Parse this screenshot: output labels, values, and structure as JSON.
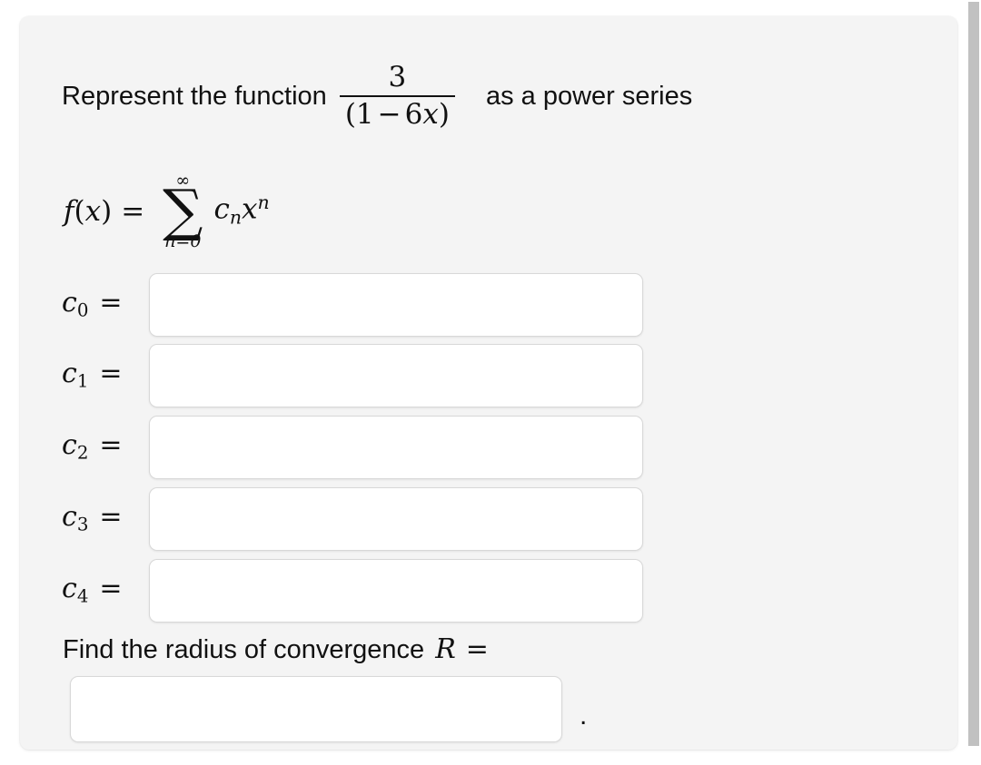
{
  "problem": {
    "statement_prefix": "Represent the function",
    "statement_suffix": "as a power series",
    "function": {
      "numerator": "3",
      "denominator_open": "(1",
      "denominator_minus": "−",
      "denominator_coefficient": "6",
      "denominator_variable": "x",
      "denominator_close": ")"
    },
    "series_definition": {
      "lhs_f": "f",
      "lhs_open": "(",
      "lhs_var": "x",
      "lhs_close": ")",
      "equals": "=",
      "sum_symbol": "∑",
      "sum_upper_limit": "∞",
      "sum_lower_limit": "n=0",
      "term_coefficient": "c",
      "term_coefficient_sub": "n",
      "term_variable": "x",
      "term_exponent": "n"
    },
    "coefficients": [
      {
        "label": "c",
        "subscript": "0",
        "equals": "=",
        "value": "",
        "placeholder": ""
      },
      {
        "label": "c",
        "subscript": "1",
        "equals": "=",
        "value": "",
        "placeholder": ""
      },
      {
        "label": "c",
        "subscript": "2",
        "equals": "=",
        "value": "",
        "placeholder": ""
      },
      {
        "label": "c",
        "subscript": "3",
        "equals": "=",
        "value": "",
        "placeholder": ""
      },
      {
        "label": "c",
        "subscript": "4",
        "equals": "=",
        "value": "",
        "placeholder": ""
      }
    ],
    "radius": {
      "prompt": "Find the radius of convergence",
      "symbol": "R",
      "equals": "=",
      "value": "",
      "placeholder": "",
      "trailing_punctuation": "."
    }
  },
  "colors": {
    "page_background": "#ffffff",
    "card_background": "#f4f4f4",
    "text": "#111111",
    "input_background": "#ffffff",
    "input_border": "#d8d8d8",
    "scrollbar_thumb": "#c1c1c1"
  }
}
